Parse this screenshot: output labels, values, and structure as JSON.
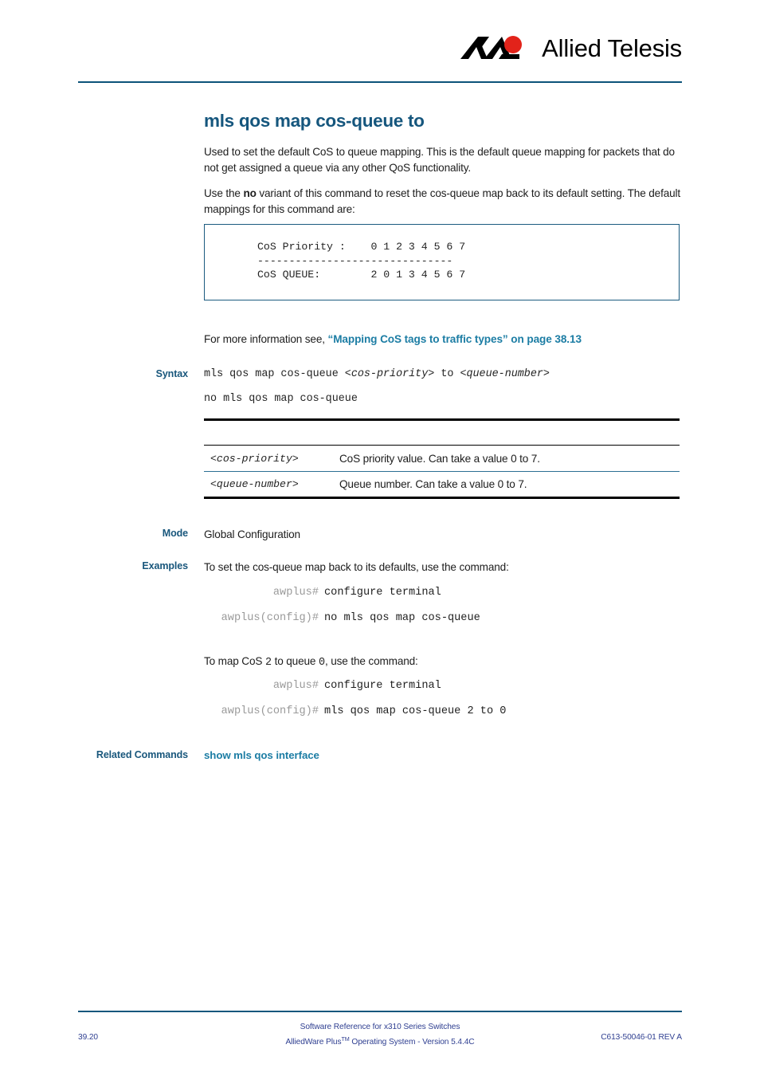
{
  "brand": {
    "logo_text": "Allied Telesis",
    "logo_icon": "allied-telesis-chevron-mark",
    "accent_dark": "#15567d",
    "accent_link": "#1c7da4",
    "rule_color": "#0c5379",
    "logo_red": "#e2231a"
  },
  "page": {
    "title": "mls qos map cos-queue to",
    "intro_paragraph": "Used to set the default CoS to queue mapping. This is the default queue mapping for packets that do not get assigned a queue via any other QoS functionality.",
    "no_variant": {
      "before": "Use the ",
      "bold": "no",
      "after": " variant of this command to reset the cos-queue map back to its default setting. The default mappings for this command are:"
    },
    "code_sample": "CoS Priority :    0 1 2 3 4 5 6 7\n-------------------------------\nCoS QUEUE:        2 0 1 3 4 5 6 7",
    "more_info": {
      "prefix": "For more information see, ",
      "link_text": "“Mapping CoS tags to traffic types” on page 38.13"
    }
  },
  "sections": {
    "syntax": {
      "label": "Syntax",
      "line1": {
        "prefix": "mls qos map cos-queue <",
        "param1": "cos-priority",
        "middle": "> to <",
        "param2": "queue-number",
        "suffix": ">"
      },
      "line2": "no mls qos map cos-queue"
    },
    "parameters": {
      "rows": [
        {
          "name": "<cos-priority>",
          "description": "CoS priority value. Can take a value 0 to 7."
        },
        {
          "name": "<queue-number>",
          "description": "Queue number. Can take a value 0 to 7."
        }
      ]
    },
    "mode": {
      "label": "Mode",
      "value": "Global Configuration"
    },
    "examples": {
      "label": "Examples",
      "example1": {
        "intro": "To set the cos-queue map back to its defaults, use the command:",
        "lines": [
          {
            "prompt": "awplus#",
            "command": "configure terminal"
          },
          {
            "prompt": "awplus(config)#",
            "command": "no mls qos map cos-queue"
          }
        ]
      },
      "example2": {
        "intro_prefix": "To map CoS ",
        "intro_mono1": "2",
        "intro_middle": " to queue ",
        "intro_mono2": "0",
        "intro_suffix": ", use the command:",
        "lines": [
          {
            "prompt": "awplus#",
            "command": "configure terminal"
          },
          {
            "prompt": "awplus(config)#",
            "command": "mls qos map cos-queue 2 to 0"
          }
        ]
      }
    },
    "related_commands": {
      "label": "Related Commands",
      "links": [
        "show mls qos interface"
      ]
    }
  },
  "footer": {
    "page_number": "39.20",
    "center_line1": "Software Reference for x310 Series Switches",
    "center_line2_a": "AlliedWare Plus",
    "center_line2_sup": "TM",
    "center_line2_b": " Operating System  - Version 5.4.4C",
    "doc_id": "C613-50046-01 REV A"
  }
}
